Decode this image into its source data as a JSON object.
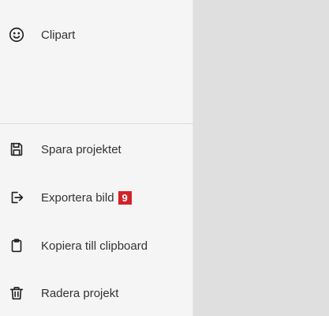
{
  "menu": {
    "top_items": [
      {
        "label": "Clipart",
        "icon": "smiley-icon"
      }
    ],
    "bottom_items": [
      {
        "label": "Spara projektet",
        "icon": "floppy-disk-icon"
      },
      {
        "label": "Exportera bild",
        "icon": "export-icon",
        "badge": "9"
      },
      {
        "label": "Kopiera till clipboard",
        "icon": "clipboard-icon"
      },
      {
        "label": "Radera projekt",
        "icon": "trash-icon"
      }
    ]
  },
  "colors": {
    "sidebar_bg": "#f5f5f5",
    "canvas_bg": "#dedfde",
    "badge_bg": "#d2232a",
    "text": "#333333"
  }
}
